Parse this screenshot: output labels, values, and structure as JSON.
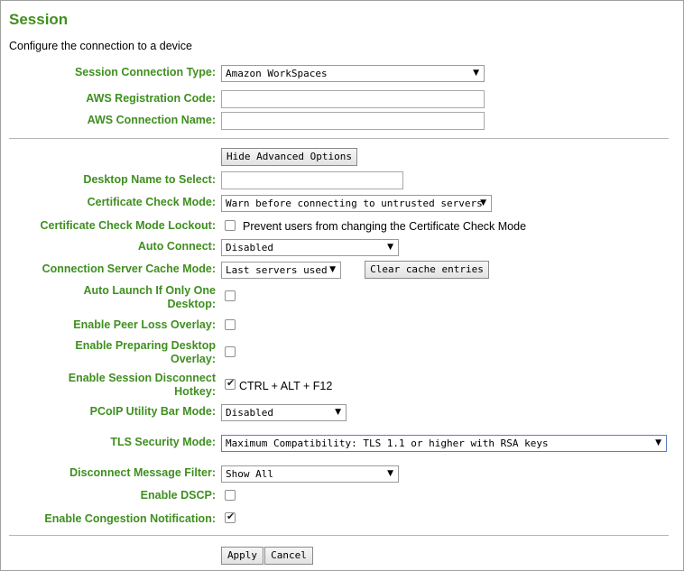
{
  "page": {
    "title": "Session",
    "subtitle": "Configure the connection to a device"
  },
  "fields": {
    "session_connection_type": {
      "label": "Session Connection Type:",
      "value": "Amazon WorkSpaces"
    },
    "aws_registration_code": {
      "label": "AWS Registration Code:",
      "value": ""
    },
    "aws_connection_name": {
      "label": "AWS Connection Name:",
      "value": ""
    },
    "desktop_name": {
      "label": "Desktop Name to Select:",
      "value": ""
    },
    "certificate_check_mode": {
      "label": "Certificate Check Mode:",
      "value": "Warn before connecting to untrusted servers"
    },
    "certificate_check_mode_lockout": {
      "label": "Certificate Check Mode Lockout:",
      "checked": false,
      "option_text": "Prevent users from changing the Certificate Check Mode"
    },
    "auto_connect": {
      "label": "Auto Connect:",
      "value": "Disabled"
    },
    "connection_server_cache_mode": {
      "label": "Connection Server Cache Mode:",
      "value": "Last servers used"
    },
    "auto_launch": {
      "label_line1": "Auto Launch If Only One",
      "label_line2": "Desktop:",
      "checked": false
    },
    "peer_loss_overlay": {
      "label": "Enable Peer Loss Overlay:",
      "checked": false
    },
    "preparing_desktop_overlay": {
      "label_line1": "Enable Preparing Desktop",
      "label_line2": "Overlay:",
      "checked": false
    },
    "session_disconnect_hotkey": {
      "label_line1": "Enable Session Disconnect",
      "label_line2": "Hotkey:",
      "checked": true,
      "option_text": "CTRL + ALT + F12"
    },
    "pcoip_utility_bar_mode": {
      "label": "PCoIP Utility Bar Mode:",
      "value": "Disabled"
    },
    "tls_security_mode": {
      "label": "TLS Security Mode:",
      "value": "Maximum Compatibility: TLS 1.1 or higher with RSA keys"
    },
    "disconnect_message_filter": {
      "label": "Disconnect Message Filter:",
      "value": "Show All"
    },
    "enable_dscp": {
      "label": "Enable DSCP:",
      "checked": false
    },
    "enable_congestion_notification": {
      "label": "Enable Congestion Notification:",
      "checked": true
    }
  },
  "buttons": {
    "hide_advanced": "Hide Advanced Options",
    "clear_cache": "Clear cache entries",
    "apply": "Apply",
    "cancel": "Cancel"
  },
  "icons": {
    "dropdown": "triangle-down-icon",
    "check": "check-icon"
  },
  "colors": {
    "label_green": "#3f8f1f",
    "border_gray": "#a0a0a0",
    "focus_blue": "#5b7fbf"
  }
}
